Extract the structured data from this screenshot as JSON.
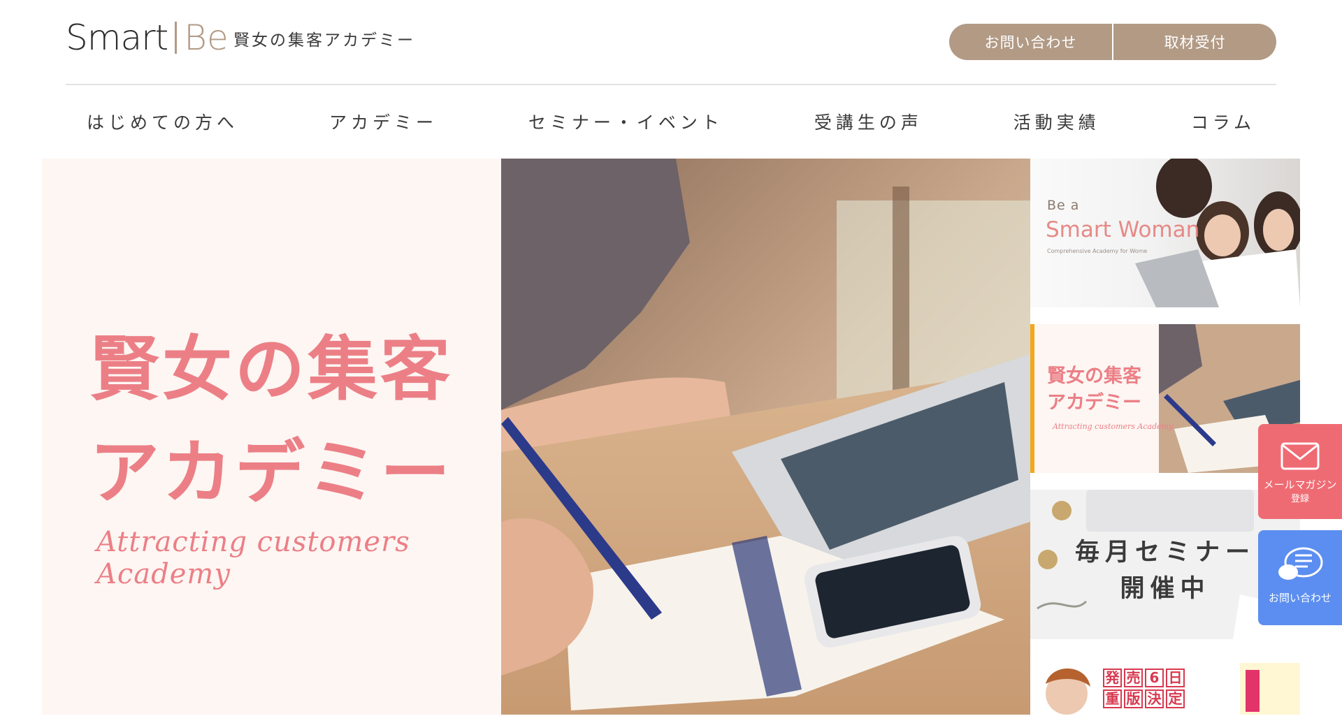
{
  "header": {
    "logo_smart": "Smart",
    "logo_be": "Be",
    "tagline": "賢女の集客アカデミー",
    "contact_button": "お問い合わせ",
    "press_button": "取材受付"
  },
  "nav": {
    "items": [
      {
        "label": "はじめての方へ"
      },
      {
        "label": "アカデミー"
      },
      {
        "label": "セミナー・イベント"
      },
      {
        "label": "受講生の声"
      },
      {
        "label": "活動実績"
      },
      {
        "label": "コラム"
      }
    ]
  },
  "hero": {
    "title": "賢女の集客\nアカデミー",
    "subtitle": "Attracting customers Academy"
  },
  "side_banners": {
    "smart_woman": {
      "be_a": "Be a",
      "title": "Smart Woman",
      "caption": "Comprehensive Academy for Wome"
    },
    "academy": {
      "title": "賢女の集客\nアカデミー",
      "subtitle": "Attracting customers Academy"
    },
    "seminar": {
      "title": "毎月セミナー\n開催中"
    },
    "book": {
      "chars": [
        "発",
        "売",
        "6",
        "日",
        "重",
        "版",
        "決",
        "定"
      ]
    }
  },
  "floating": {
    "mail_label": "メールマガジン",
    "mail_sub": "登録",
    "contact_label": "お問い合わせ"
  },
  "colors": {
    "accent_brown": "#b29a85",
    "pink": "#ec7f86",
    "mail_tab": "#ef6b73",
    "contact_tab": "#5b8ef0",
    "highlight": "#f2a81c"
  }
}
